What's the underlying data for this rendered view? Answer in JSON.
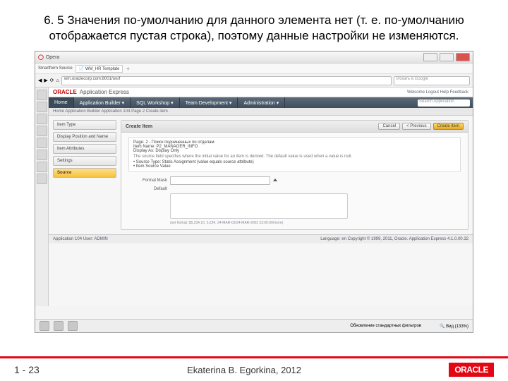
{
  "slide": {
    "title": "6. 5 Значения по-умолчанию для данного элемента нет (т. е. по-умолчанию отображается пустая строка), поэтому  данные настройки не изменяются."
  },
  "window": {
    "title": "Opera",
    "url": "wm.oraclecorp.com:8001/ws/f",
    "search_ph": "Искать в Google"
  },
  "oracle": {
    "logo": "ORACLE",
    "app": "Application Express",
    "links": "Welcome  Logout  Help  Feedback"
  },
  "nav": {
    "home": "Home",
    "builder": "Application Builder ▾",
    "sql": "SQL Workshop ▾",
    "team": "Team Development ▾",
    "admin": "Administration ▾",
    "find": "Search Application"
  },
  "breadcrumb": "Home  Application Builder  Application 104  Page 2  Create item",
  "wizard": {
    "step1": "Item Type",
    "step2": "Display Position and Name",
    "step3": "Item Attributes",
    "step4": "Settings",
    "step5": "Source",
    "header": "Create Item",
    "btn_cancel": "Cancel",
    "btn_prev": "< Previous",
    "btn_create": "Create Item",
    "info_line1": "Page: 2 - Поиск подчиненных по отделам",
    "info_line2": "Item Name: P2_MANAGER_INFO",
    "info_line3": "Display As: Display Only",
    "info_line4": "The source field specifies where the initial value for an item is derived. The default value is used when a value is null.",
    "info_line5": "• Source Type: Static Assignment (value equals source attribute)",
    "info_line6": "• Item Source Value",
    "label_format": "Format Mask",
    "label_default": "Default",
    "help": "(set format: $5,234.10, 5,234, 24-MAR-02/24-MAR-2002 23:00:00/more)"
  },
  "status": {
    "left": "Application 104  User: ADMIN",
    "right": "Language: en  Copyright © 1999, 2011, Oracle.   Application Express 4.1.0.00.32"
  },
  "dw": {
    "text": "Обновление стандартных фильтров",
    "zoom": "Вид (133%)"
  },
  "footer": {
    "page": "1 - 23",
    "author": "Ekaterina B. Egorkina, 2012",
    "logo": "ORACLE"
  }
}
